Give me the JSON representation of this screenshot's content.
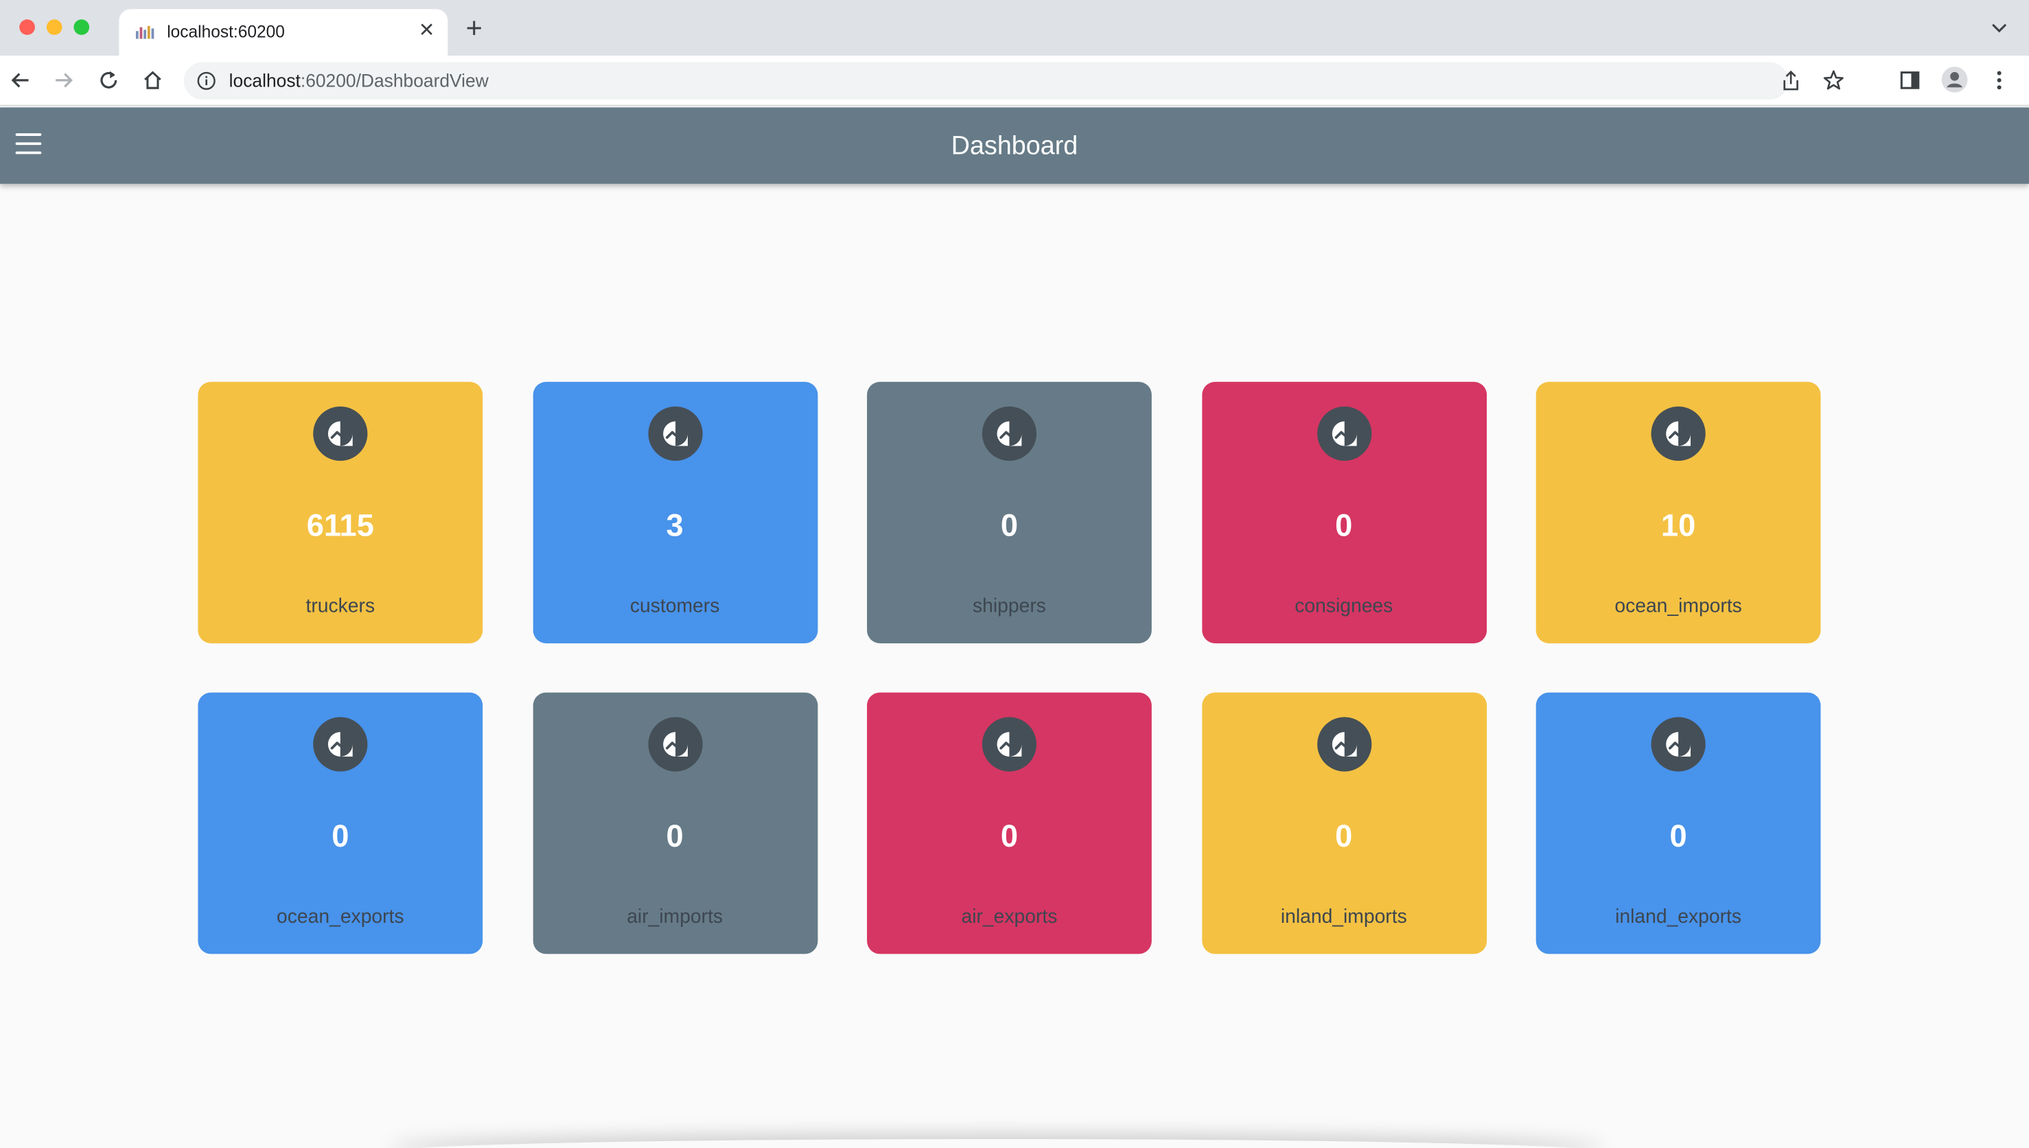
{
  "browser": {
    "tab_title": "localhost:60200",
    "url_host": "localhost",
    "url_rest": ":60200/DashboardView",
    "new_tab_label": "+",
    "close_tab_label": "✕"
  },
  "appbar": {
    "title": "Dashboard"
  },
  "cards": [
    {
      "value": "6115",
      "label": "truckers",
      "color": "#f4c142"
    },
    {
      "value": "3",
      "label": "customers",
      "color": "#4893eb"
    },
    {
      "value": "0",
      "label": "shippers",
      "color": "#667b87"
    },
    {
      "value": "0",
      "label": "consignees",
      "color": "#d63663"
    },
    {
      "value": "10",
      "label": "ocean_imports",
      "color": "#f4c142"
    },
    {
      "value": "0",
      "label": "ocean_exports",
      "color": "#4893eb"
    },
    {
      "value": "0",
      "label": "air_imports",
      "color": "#667b87"
    },
    {
      "value": "0",
      "label": "air_exports",
      "color": "#d63663"
    },
    {
      "value": "0",
      "label": "inland_imports",
      "color": "#f4c142"
    },
    {
      "value": "0",
      "label": "inland_exports",
      "color": "#4893eb"
    }
  ],
  "icons": {
    "card_icon": "trending-up-icon",
    "menu_icon": "hamburger-menu-icon"
  }
}
